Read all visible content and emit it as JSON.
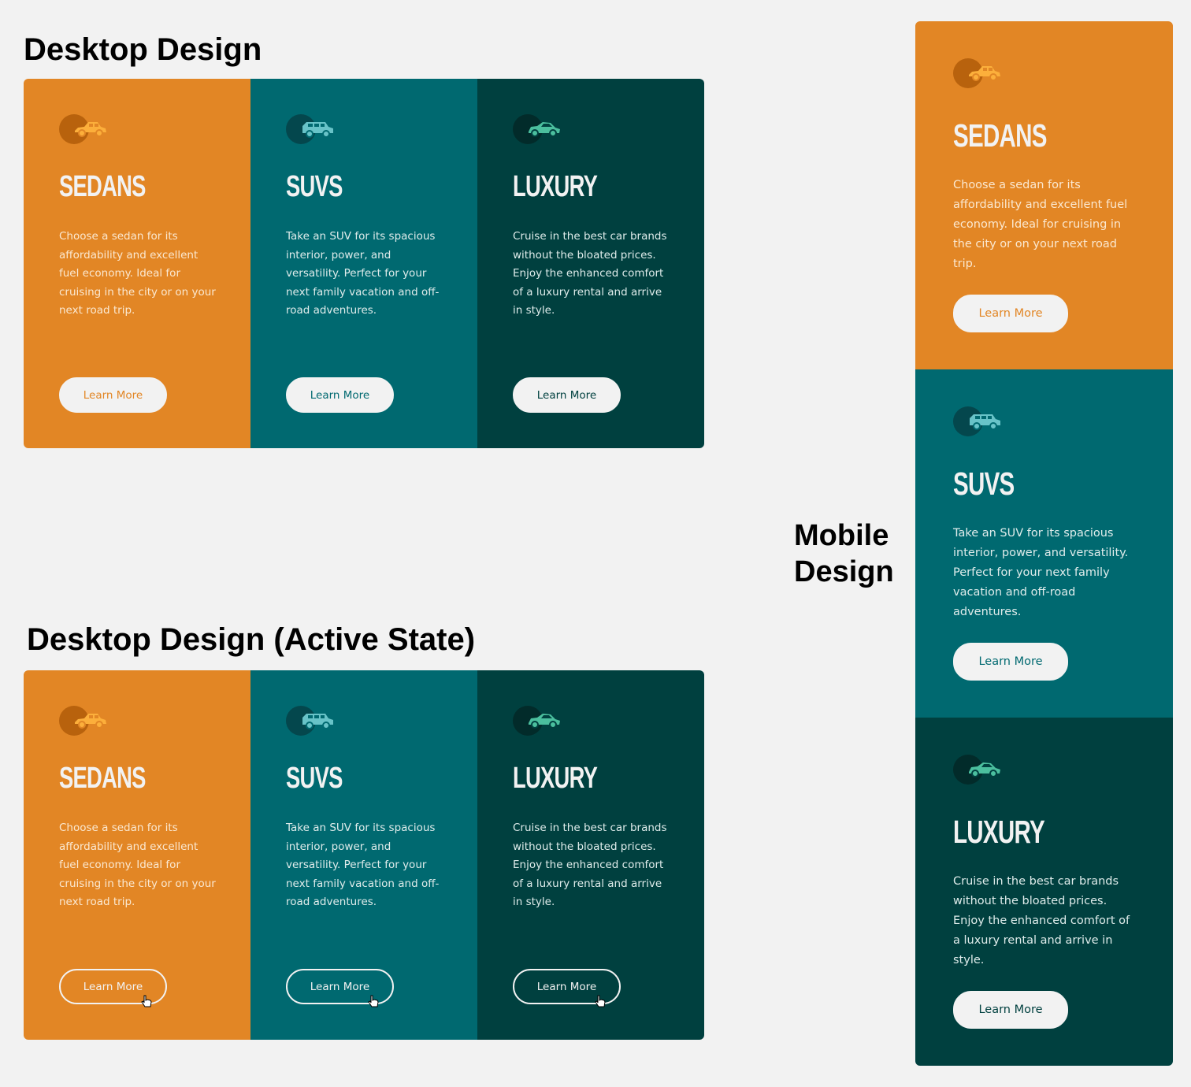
{
  "headings": {
    "desktop": "Desktop Design",
    "active": "Desktop Design (Active State)",
    "mobile": "Mobile Design"
  },
  "colors": {
    "sedans": "#e28625",
    "suvs": "#006970",
    "luxury": "#00403f",
    "page_background": "#f2f2f2",
    "button": "#f2f2f2"
  },
  "cards": [
    {
      "icon": "sedan-car-icon",
      "title": "SEDANS",
      "text": "Choose a sedan for its affordability and excellent fuel economy. Ideal for cruising in the city or on your next road trip.",
      "button": "Learn More"
    },
    {
      "icon": "suv-car-icon",
      "title": "SUVS",
      "text": "Take an SUV for its spacious interior, power, and versatility. Perfect for your next family vacation and off-road adventures.",
      "button": "Learn More"
    },
    {
      "icon": "luxury-car-icon",
      "title": "LUXURY",
      "text": "Cruise in the best car brands without the bloated prices. Enjoy the enhanced comfort of a luxury rental and arrive in style.",
      "button": "Learn More"
    }
  ]
}
